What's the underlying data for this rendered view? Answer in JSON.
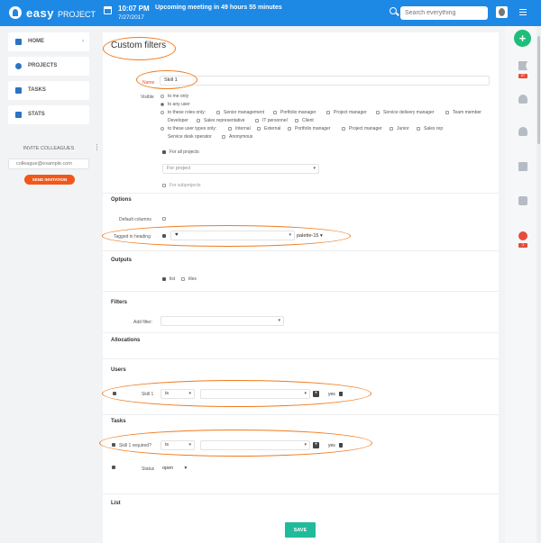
{
  "topbar": {
    "logo_main": "easy",
    "logo_sub": "PROJECT",
    "time": "10:07 PM",
    "meeting": "Upcoming meeting in 49 hours 55 minutes",
    "date": "7/27/2017",
    "search_placeholder": "Search everything"
  },
  "sidebar": {
    "items": [
      {
        "label": "HOME",
        "icon": "dashboard-icon"
      },
      {
        "label": "PROJECTS",
        "icon": "projects-icon"
      },
      {
        "label": "TASKS",
        "icon": "tasks-icon"
      },
      {
        "label": "STATS",
        "icon": "stats-icon"
      }
    ],
    "invite_title": "INVITE COLLEAGUES",
    "invite_placeholder": "colleague@example.com",
    "invite_button": "SEND INVITATION"
  },
  "form": {
    "title": "Custom filters",
    "name_label": "Name",
    "name_value": "Skill 1",
    "visible_label": "Visible",
    "visible_opt1": "to me only",
    "visible_opt2": "to any user",
    "visible_opt3": "to these roles only:",
    "roles": [
      "Senior management",
      "Portfolio manager",
      "Project manager",
      "Service delivery manager",
      "Team member",
      "Developer",
      "Sales representative",
      "IT personnel",
      "Client"
    ],
    "visible_opt4": "to these user types only:",
    "user_types": [
      "Internal",
      "External",
      "Portfolio manager",
      "Project manager",
      "Junior",
      "Sales rep"
    ],
    "user_types_row2": [
      "Service desk operator",
      "Anonymous"
    ],
    "for_all_projects": "For all projects",
    "for_project_placeholder": "For project",
    "for_subprojects": "For subprojects",
    "options_title": "Options",
    "default_columns": "Default columns",
    "tagged_heading": "Tagged in heading",
    "palette": "palette-15",
    "outputs_title": "Outputs",
    "output_list": "list",
    "output_tiles": "tiles",
    "filters_title": "Filters",
    "add_filter": "Add filter:",
    "allocations_title": "Allocations",
    "users_title": "Users",
    "users_field": "Skill 1",
    "users_operator": "is",
    "users_yes": "yes",
    "tasks_title": "Tasks",
    "tasks_field": "Skill 1 required?",
    "tasks_operator": "is",
    "tasks_yes": "yes",
    "status_label": "Status",
    "status_value": "open",
    "list_title": "List",
    "save_button": "SAVE"
  },
  "rightbar": {
    "badge1": "87",
    "badge2": "3"
  },
  "colors": {
    "topbar": "#1e88e5",
    "accent_orange": "#f07a1d",
    "save": "#21bb9b",
    "add": "#1ebd7a"
  }
}
